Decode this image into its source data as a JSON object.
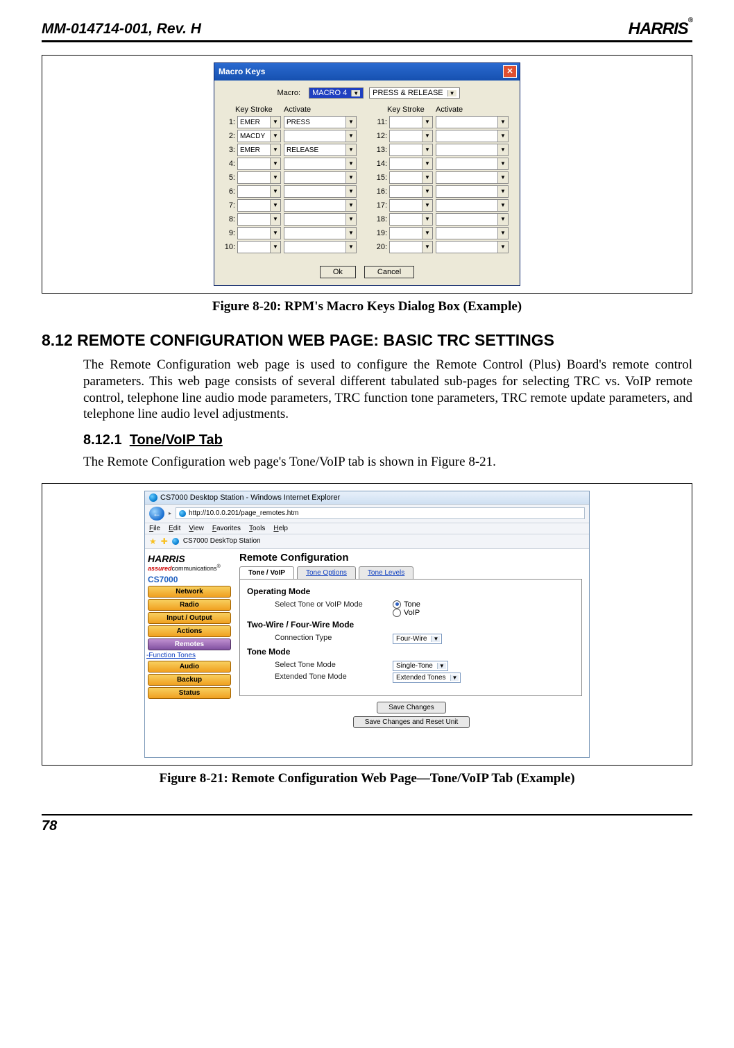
{
  "header": {
    "doc_id": "MM-014714-001, Rev. H",
    "brand": "HARRIS",
    "reg": "®"
  },
  "footer": {
    "page": "78"
  },
  "fig820": {
    "title": "Macro Keys",
    "macro_label": "Macro:",
    "macro_value": "MACRO 4",
    "press_release": "PRESS & RELEASE",
    "head_keystroke": "Key Stroke",
    "head_activate": "Activate",
    "rows_left": [
      {
        "n": "1:",
        "ks": "EMER",
        "ac": "PRESS"
      },
      {
        "n": "2:",
        "ks": "MACDY",
        "ac": ""
      },
      {
        "n": "3:",
        "ks": "EMER",
        "ac": "RELEASE"
      },
      {
        "n": "4:",
        "ks": "",
        "ac": ""
      },
      {
        "n": "5:",
        "ks": "",
        "ac": ""
      },
      {
        "n": "6:",
        "ks": "",
        "ac": ""
      },
      {
        "n": "7:",
        "ks": "",
        "ac": ""
      },
      {
        "n": "8:",
        "ks": "",
        "ac": ""
      },
      {
        "n": "9:",
        "ks": "",
        "ac": ""
      },
      {
        "n": "10:",
        "ks": "",
        "ac": ""
      }
    ],
    "rows_right": [
      {
        "n": "11:",
        "ks": "",
        "ac": ""
      },
      {
        "n": "12:",
        "ks": "",
        "ac": ""
      },
      {
        "n": "13:",
        "ks": "",
        "ac": ""
      },
      {
        "n": "14:",
        "ks": "",
        "ac": ""
      },
      {
        "n": "15:",
        "ks": "",
        "ac": ""
      },
      {
        "n": "16:",
        "ks": "",
        "ac": ""
      },
      {
        "n": "17:",
        "ks": "",
        "ac": ""
      },
      {
        "n": "18:",
        "ks": "",
        "ac": ""
      },
      {
        "n": "19:",
        "ks": "",
        "ac": ""
      },
      {
        "n": "20:",
        "ks": "",
        "ac": ""
      }
    ],
    "ok": "Ok",
    "cancel": "Cancel",
    "caption": "Figure 8-20:  RPM's Macro Keys Dialog Box (Example)"
  },
  "section": {
    "h2": "8.12  REMOTE CONFIGURATION WEB PAGE:  BASIC TRC SETTINGS",
    "p1": "The Remote Configuration web page is used to configure the Remote Control (Plus) Board's remote control parameters. This web page consists of several different tabulated sub-pages for selecting TRC vs. VoIP remote control, telephone line audio mode parameters, TRC function tone parameters, TRC remote update parameters, and telephone line audio level adjustments.",
    "h3_num": "8.12.1",
    "h3_title": "Tone/VoIP Tab",
    "p2": "The Remote Configuration web page's Tone/VoIP tab is shown in Figure 8-21."
  },
  "fig821": {
    "browser_title": "CS7000 Desktop Station - Windows Internet Explorer",
    "url": "http://10.0.0.201/page_remotes.htm",
    "menus": [
      "File",
      "Edit",
      "View",
      "Favorites",
      "Tools",
      "Help"
    ],
    "fav_label": "CS7000 DeskTop Station",
    "side": {
      "brand": "HARRIS",
      "assured_pre": "assured",
      "assured_post": "communications",
      "model": "CS7000",
      "items": [
        "Network",
        "Radio",
        "Input / Output",
        "Actions",
        "Remotes"
      ],
      "link": "-Function Tones",
      "items2": [
        "Audio",
        "Backup",
        "Status"
      ]
    },
    "main": {
      "title": "Remote Configuration",
      "tabs": [
        "Tone / VoIP",
        "Tone Options",
        "Tone Levels"
      ],
      "op_mode_title": "Operating Mode",
      "op_mode_label": "Select Tone or VoIP Mode",
      "op_tone": "Tone",
      "op_voip": "VoIP",
      "wire_title": "Two-Wire / Four-Wire Mode",
      "wire_label": "Connection Type",
      "wire_value": "Four-Wire",
      "tone_title": "Tone Mode",
      "tone_label": "Select Tone Mode",
      "tone_value": "Single-Tone",
      "ext_label": "Extended Tone Mode",
      "ext_value": "Extended Tones",
      "save": "Save Changes",
      "save_reset": "Save Changes and Reset Unit"
    },
    "caption": "Figure 8-21:  Remote Configuration Web Page—Tone/VoIP Tab (Example)"
  }
}
